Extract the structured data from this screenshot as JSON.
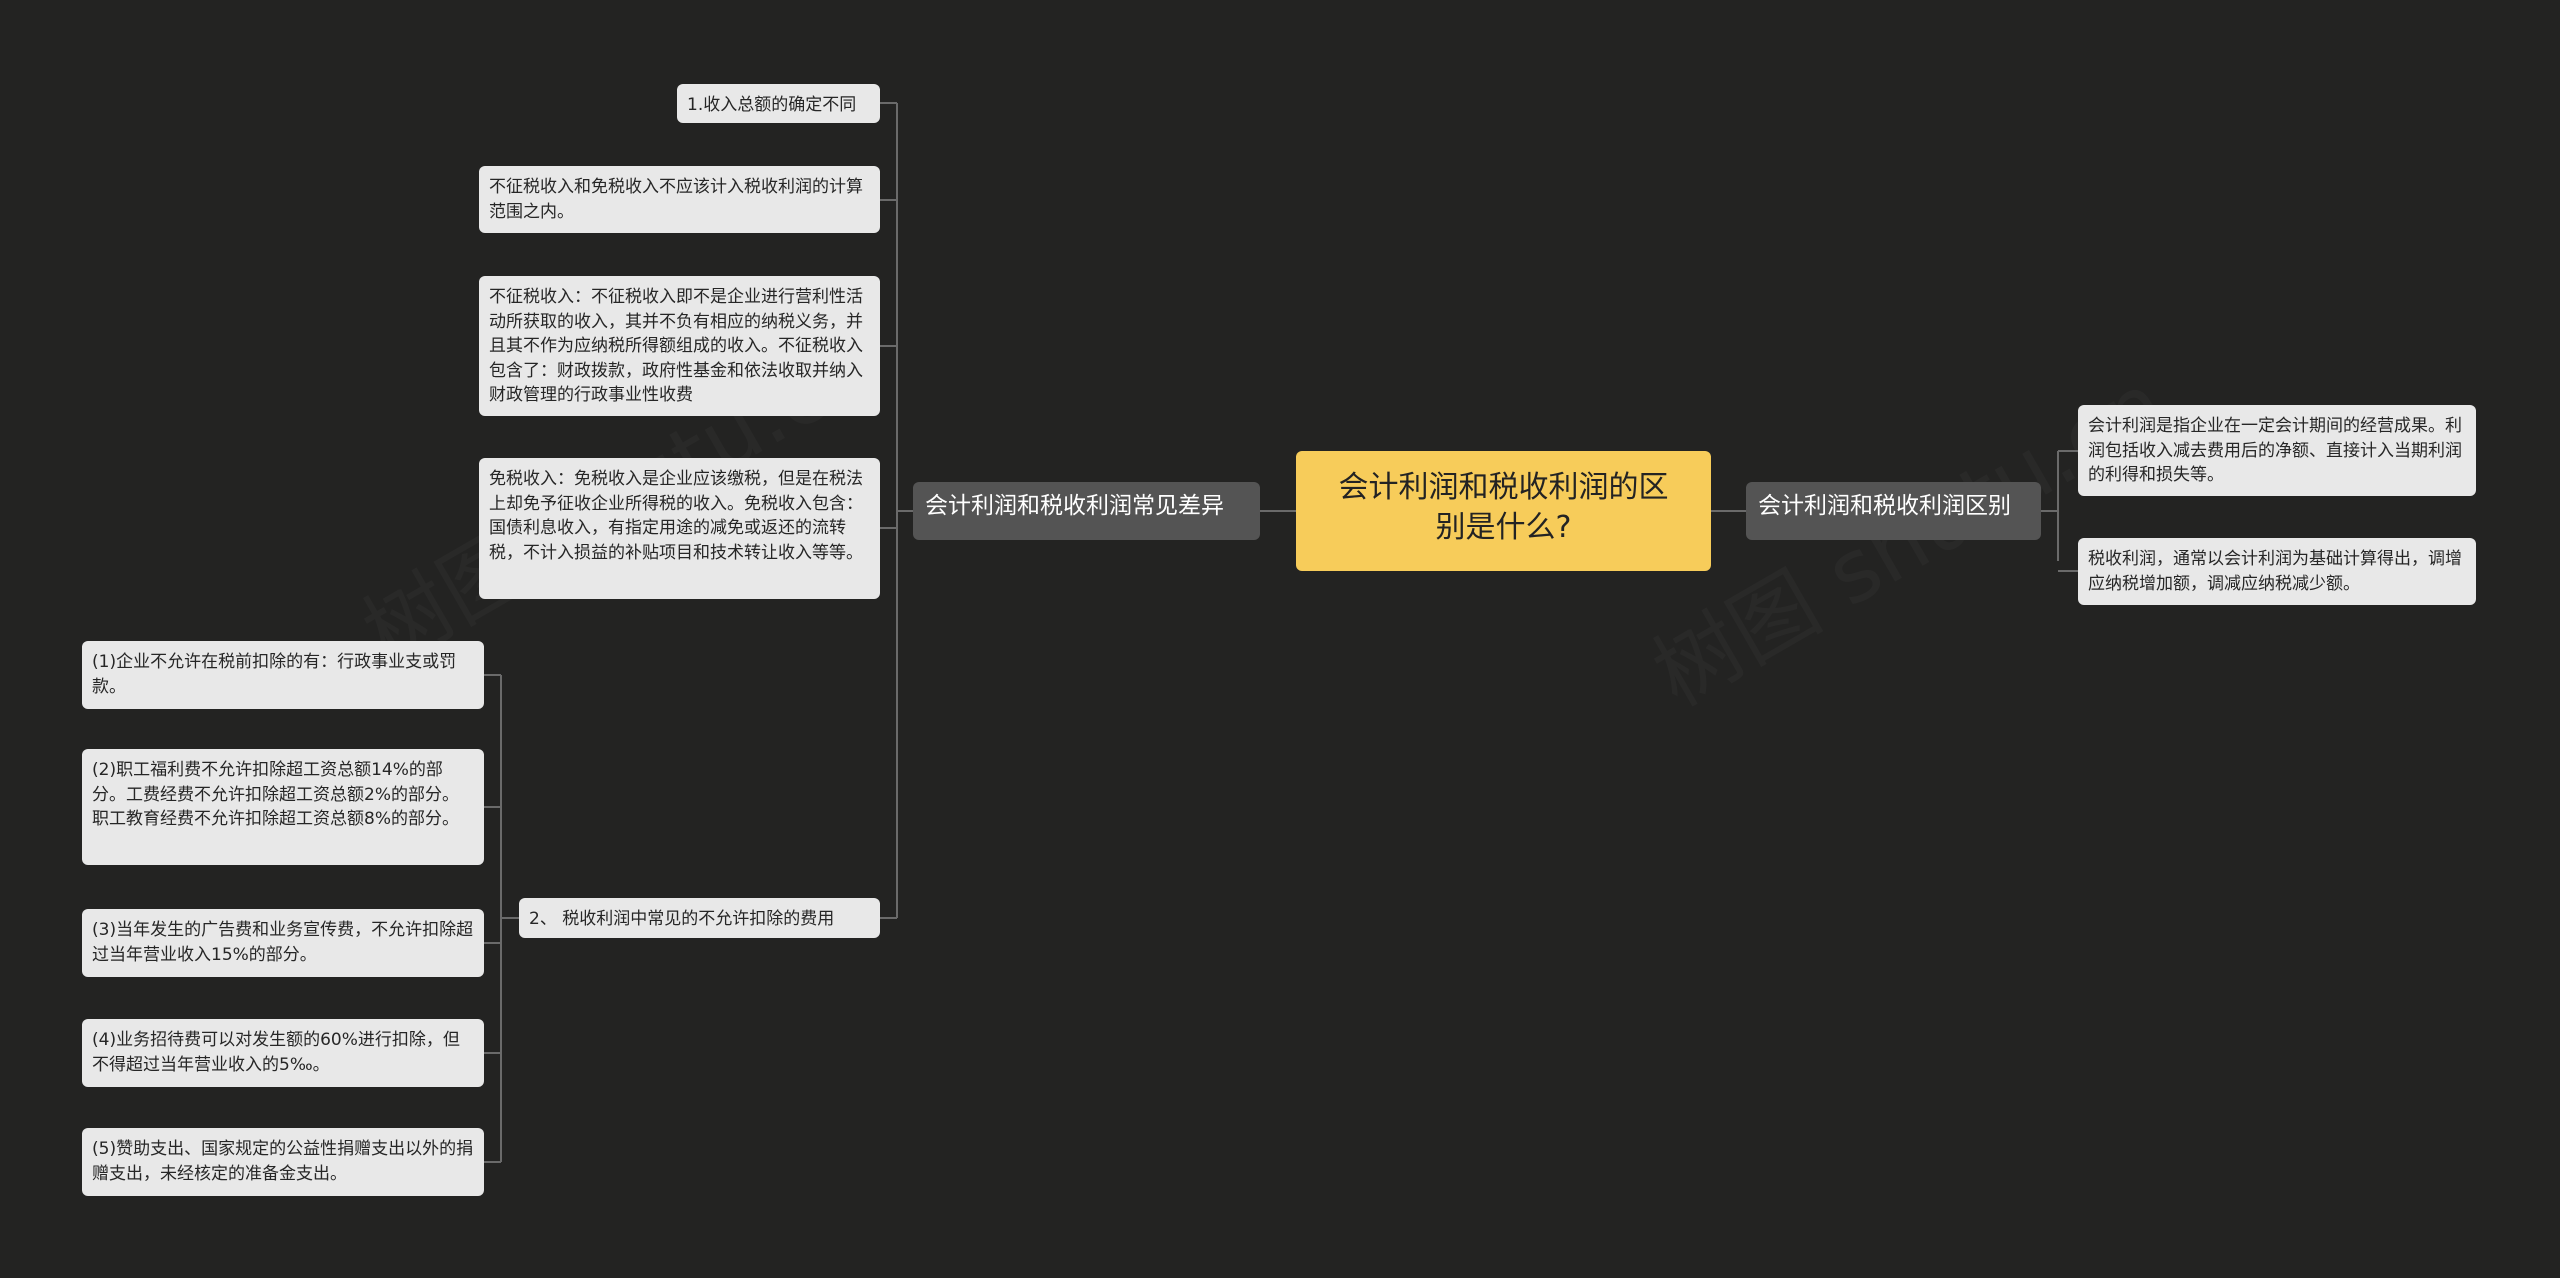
{
  "root": {
    "title": "会计利润和税收利润的区别是什么?"
  },
  "right_branch": {
    "label": "会计利润和税收利润区别",
    "items": [
      "会计利润是指企业在一定会计期间的经营成果。利润包括收入减去费用后的净额、直接计入当期利润的利得和损失等。",
      "税收利润，通常以会计利润为基础计算得出，调增应纳税增加额，调减应纳税减少额。"
    ]
  },
  "left_branch": {
    "label": "会计利润和税收利润常见差异",
    "items": [
      "1.收入总额的确定不同",
      "不征税收入和免税收入不应该计入税收利润的计算范围之内。",
      "不征税收入：不征税收入即不是企业进行营利性活动所获取的收入，其并不负有相应的纳税义务，并且其不作为应纳税所得额组成的收入。不征税收入包含了：财政拨款，政府性基金和依法收取并纳入财政管理的行政事业性收费",
      "免税收入：免税收入是企业应该缴税，但是在税法上却免予征收企业所得税的收入。免税收入包含：国债利息收入，有指定用途的减免或返还的流转税，不计入损益的补贴项目和技术转让收入等等。",
      "2、 税收利润中常见的不允许扣除的费用"
    ],
    "sub_items": [
      "(1)企业不允许在税前扣除的有：行政事业支或罚款。",
      "(2)职工福利费不允许扣除超工资总额14%的部分。工费经费不允许扣除超工资总额2%的部分。职工教育经费不允许扣除超工资总额8%的部分。",
      "(3)当年发生的广告费和业务宣传费，不允许扣除超过当年营业收入15%的部分。",
      "(4)业务招待费可以对发生额的60%进行扣除，但不得超过当年营业收入的5‰。",
      "(5)赞助支出、国家规定的公益性捐赠支出以外的捐赠支出，未经核定的准备金支出。"
    ]
  },
  "colors": {
    "background": "#232322",
    "root": "#f7cc5a",
    "branch": "#545454",
    "leaf": "#e8e8e8",
    "connector": "#6a6a6a"
  }
}
